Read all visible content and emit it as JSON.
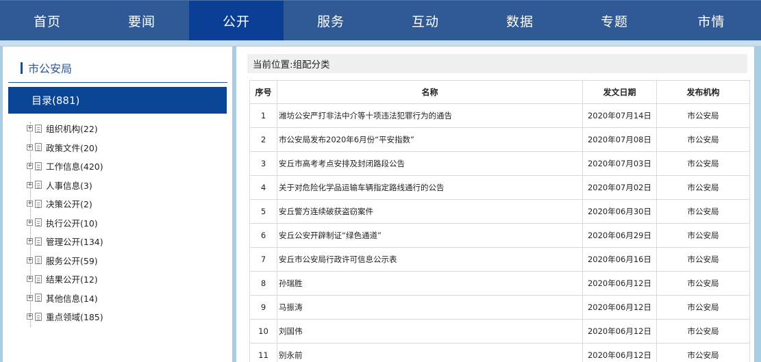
{
  "nav": {
    "items": [
      {
        "label": "首页",
        "active": false
      },
      {
        "label": "要闻",
        "active": false
      },
      {
        "label": "公开",
        "active": true
      },
      {
        "label": "服务",
        "active": false
      },
      {
        "label": "互动",
        "active": false
      },
      {
        "label": "数据",
        "active": false
      },
      {
        "label": "专题",
        "active": false
      },
      {
        "label": "市情",
        "active": false
      }
    ]
  },
  "sidebar": {
    "title": "市公安局",
    "catalog_label": "目录(881)",
    "tree": [
      "组织机构(22)",
      "政策文件(20)",
      "工作信息(420)",
      "人事信息(3)",
      "决策公开(2)",
      "执行公开(10)",
      "管理公开(134)",
      "服务公开(59)",
      "结果公开(12)",
      "其他信息(14)",
      "重点领域(185)"
    ]
  },
  "main": {
    "breadcrumb_label": "当前位置:",
    "breadcrumb_value": "组配分类",
    "table": {
      "headers": [
        "序号",
        "名称",
        "发文日期",
        "发布机构"
      ],
      "rows": [
        [
          "1",
          "潍坊公安严打非法中介等十项违法犯罪行为的通告",
          "2020年07月14日",
          "市公安局"
        ],
        [
          "2",
          "市公安局发布2020年6月份“平安指数”",
          "2020年07月08日",
          "市公安局"
        ],
        [
          "3",
          "安丘市高考考点安排及封闭路段公告",
          "2020年07月03日",
          "市公安局"
        ],
        [
          "4",
          "关于对危险化学品运输车辆指定路线通行的公告",
          "2020年07月02日",
          "市公安局"
        ],
        [
          "5",
          "安丘警方连续破获盗窃案件",
          "2020年06月30日",
          "市公安局"
        ],
        [
          "6",
          "安丘公安开辟制证“绿色通道”",
          "2020年06月29日",
          "市公安局"
        ],
        [
          "7",
          "安丘市公安局行政许可信息公示表",
          "2020年06月16日",
          "市公安局"
        ],
        [
          "8",
          "孙瑞胜",
          "2020年06月12日",
          "市公安局"
        ],
        [
          "9",
          "马振涛",
          "2020年06月12日",
          "市公安局"
        ],
        [
          "10",
          "刘国伟",
          "2020年06月12日",
          "市公安局"
        ],
        [
          "11",
          "别永前",
          "2020年06月12日",
          "市公安局"
        ]
      ]
    }
  }
}
